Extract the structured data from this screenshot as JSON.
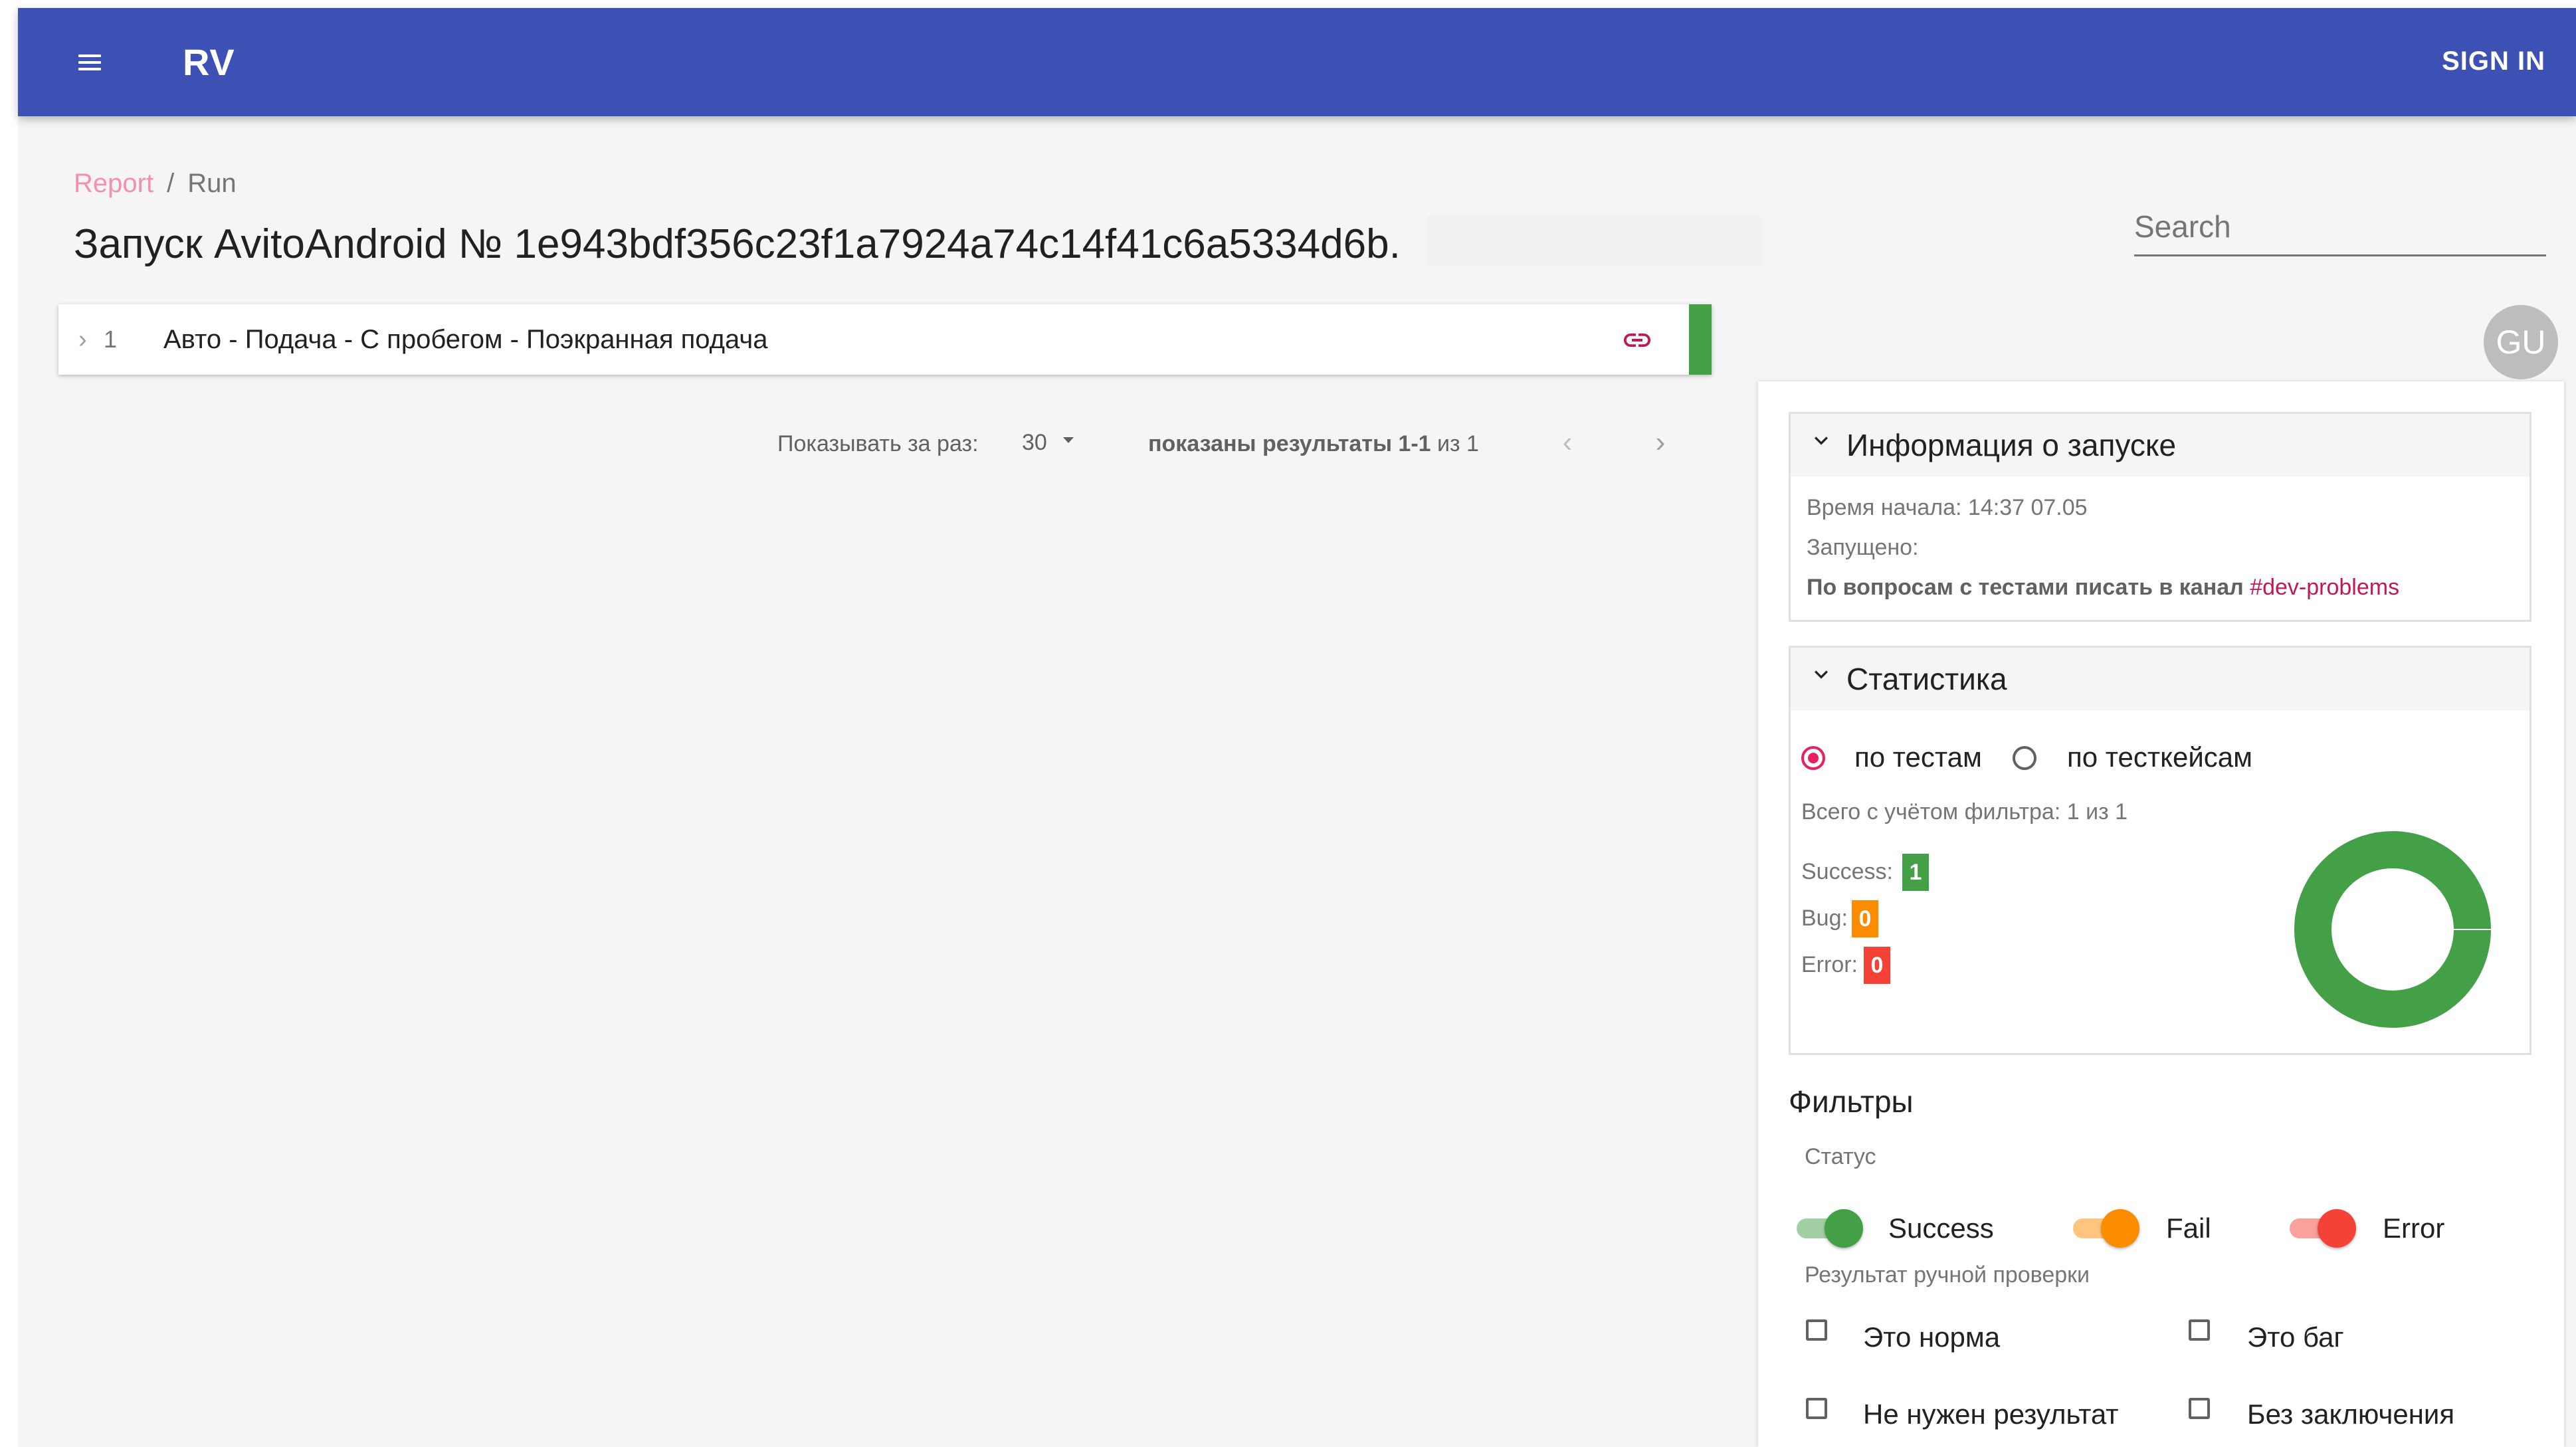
{
  "appbar": {
    "logo": "RV",
    "signin": "SIGN IN",
    "color": "#3d50b4"
  },
  "breadcrumb": {
    "report": "Report",
    "separator": "/",
    "run": "Run"
  },
  "title": "Запуск AvitoAndroid № 1e943bdf356c23f1a7924a74c14f41c6a5334d6b.",
  "search": {
    "placeholder": "Search"
  },
  "avatar": {
    "initials": "GU"
  },
  "runs": [
    {
      "index": "1",
      "name": "Авто - Подача - С пробегом - Поэкранная подача",
      "status_color": "#43a047"
    }
  ],
  "pagination": {
    "per_page_label": "Показывать за раз:",
    "per_page_value": "30",
    "shown_bold": "показаны результаты 1-1",
    "shown_rest": " из 1"
  },
  "info": {
    "title": "Информация о запуске",
    "start_time": "Время начала: 14:37 07.05",
    "launched": "Запущено:",
    "questions": "По вопросам с тестами писать в канал ",
    "channel": "#dev-problems"
  },
  "stats": {
    "title": "Статистика",
    "radio_tests": "по тестам",
    "radio_testcases": "по тесткейсам",
    "selected": "tests",
    "total": "Всего с учётом фильтра: 1 из 1",
    "success_label": "Success:",
    "success_value": "1",
    "bug_label": "Bug:",
    "bug_value": "0",
    "error_label": "Error:",
    "error_value": "0",
    "colors": {
      "success": "#43a047",
      "bug": "#fb8c00",
      "error": "#f44336"
    }
  },
  "filters": {
    "title": "Фильтры",
    "status_label": "Статус",
    "switches": [
      {
        "label": "Success",
        "on": true,
        "color": "#43a047"
      },
      {
        "label": "Fail",
        "on": true,
        "color": "#fb8c00"
      },
      {
        "label": "Error",
        "on": true,
        "color": "#f44336"
      }
    ],
    "manual_label": "Результат ручной проверки",
    "checkboxes": [
      {
        "label": "Это норма",
        "checked": false
      },
      {
        "label": "Это баг",
        "checked": false
      },
      {
        "label": "Не нужен результат",
        "checked": false
      },
      {
        "label": "Без заключения",
        "checked": false
      }
    ]
  }
}
